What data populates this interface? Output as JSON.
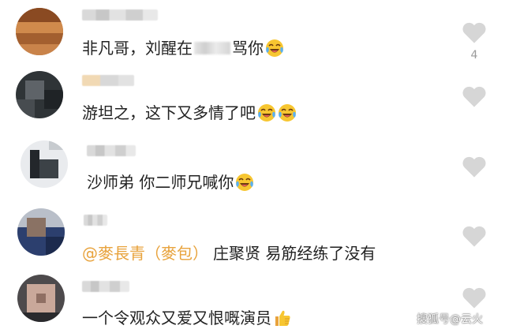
{
  "colors": {
    "like_heart": "#d6d6d6",
    "mention": "#e8a33d",
    "text": "#222222"
  },
  "comments": [
    {
      "parts": [
        "非凡哥，刘醒在",
        "骂你"
      ],
      "like_count": "4",
      "emoji": [
        "laughing-crying-emoji"
      ]
    },
    {
      "parts": [
        "游坦之，这下又多情了吧"
      ],
      "like_count": "",
      "emoji": [
        "laughing-crying-emoji",
        "laughing-crying-emoji"
      ]
    },
    {
      "parts": [
        "沙师弟 你二师兄喊你"
      ],
      "like_count": "",
      "emoji": [
        "laughing-crying-emoji"
      ]
    },
    {
      "mention": "@麥長青（麥包）",
      "parts": [
        "庄聚贤 易筋经练了没有"
      ],
      "like_count": "",
      "emoji": []
    },
    {
      "parts": [
        "一个令观众又爱又恨嘅演员"
      ],
      "like_count": "",
      "emoji": [
        "thumbs-up-emoji"
      ]
    }
  ],
  "watermark": "搜狐号@云火"
}
